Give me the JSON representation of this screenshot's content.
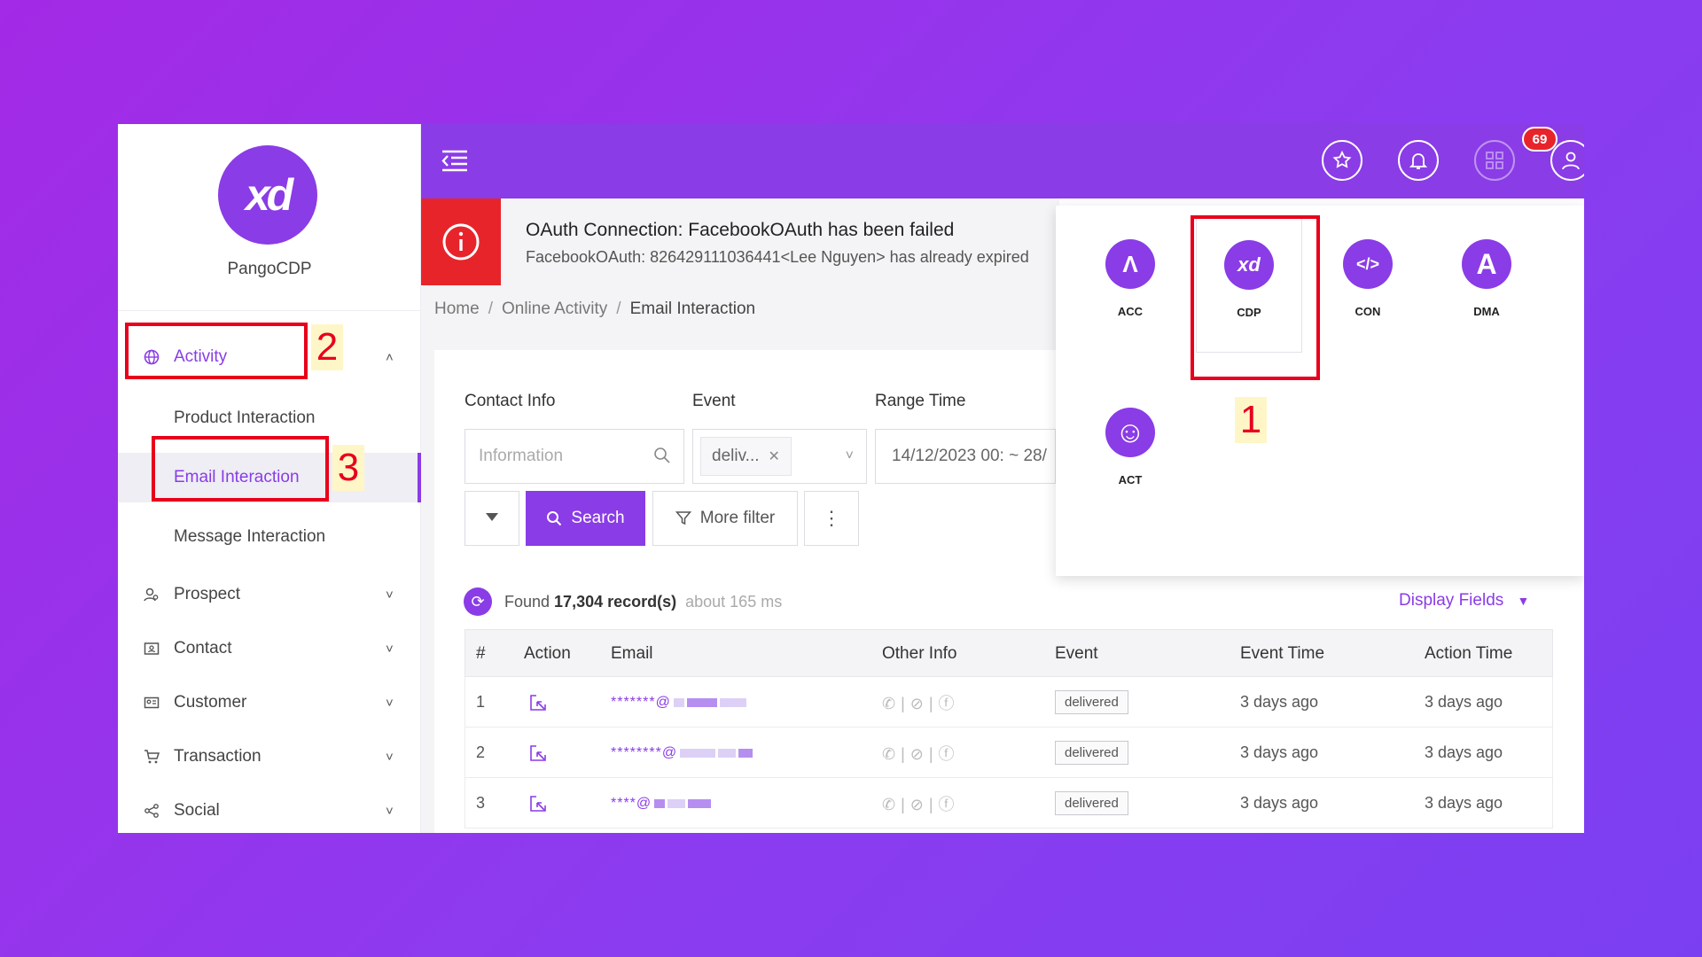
{
  "app": {
    "name": "PangoCDP",
    "logo_text": "xd"
  },
  "sidebar": {
    "activity": {
      "label": "Activity",
      "icon": "globe-icon"
    },
    "sub_items": [
      {
        "label": "Product Interaction"
      },
      {
        "label": "Email Interaction",
        "selected": true
      },
      {
        "label": "Message Interaction"
      }
    ],
    "items": [
      {
        "label": "Prospect",
        "icon": "prospect-icon"
      },
      {
        "label": "Contact",
        "icon": "contact-card-icon"
      },
      {
        "label": "Customer",
        "icon": "customer-card-icon"
      },
      {
        "label": "Transaction",
        "icon": "cart-icon"
      },
      {
        "label": "Social",
        "icon": "share-icon"
      }
    ]
  },
  "header": {
    "notification_count": "69",
    "icons": [
      "menu-icon",
      "favorite-apps-icon",
      "bell-icon",
      "apps-grid-icon",
      "user-icon"
    ],
    "accent_color": "#8a3ce6"
  },
  "alert": {
    "title": "OAuth Connection: FacebookOAuth has been failed",
    "message": "FacebookOAuth: 826429111036441<Lee Nguyen> has already expired"
  },
  "breadcrumb": [
    "Home",
    "Online Activity",
    "Email Interaction"
  ],
  "filters": {
    "contact_info_label": "Contact Info",
    "contact_info_placeholder": "Information",
    "event_label": "Event",
    "event_value": "deliv...",
    "range_time_label": "Range Time",
    "range_time_value": "14/12/2023 00: ~ 28/",
    "search_label": "Search",
    "more_filter_label": "More filter"
  },
  "results": {
    "prefix": "Found",
    "count": "17,304 record(s)",
    "timing": "about 165 ms",
    "display_fields_label": "Display Fields"
  },
  "table": {
    "columns": [
      "#",
      "Action",
      "Email",
      "Other Info",
      "Event",
      "Event Time",
      "Action Time"
    ],
    "rows": [
      {
        "num": "1",
        "email": "*******@",
        "event": "delivered",
        "event_time": "3 days ago",
        "action_time": "3 days ago"
      },
      {
        "num": "2",
        "email": "********@",
        "event": "delivered",
        "event_time": "3 days ago",
        "action_time": "3 days ago"
      },
      {
        "num": "3",
        "email": "****@",
        "event": "delivered",
        "event_time": "3 days ago",
        "action_time": "3 days ago"
      }
    ]
  },
  "app_switcher": [
    {
      "label": "ACC",
      "glyph": "Λ"
    },
    {
      "label": "CDP",
      "glyph": "xd"
    },
    {
      "label": "CON",
      "glyph": "</>"
    },
    {
      "label": "DMA",
      "glyph": "A"
    },
    {
      "label": "ACT",
      "glyph": "☺"
    }
  ],
  "annotations": [
    "1",
    "2",
    "3"
  ]
}
